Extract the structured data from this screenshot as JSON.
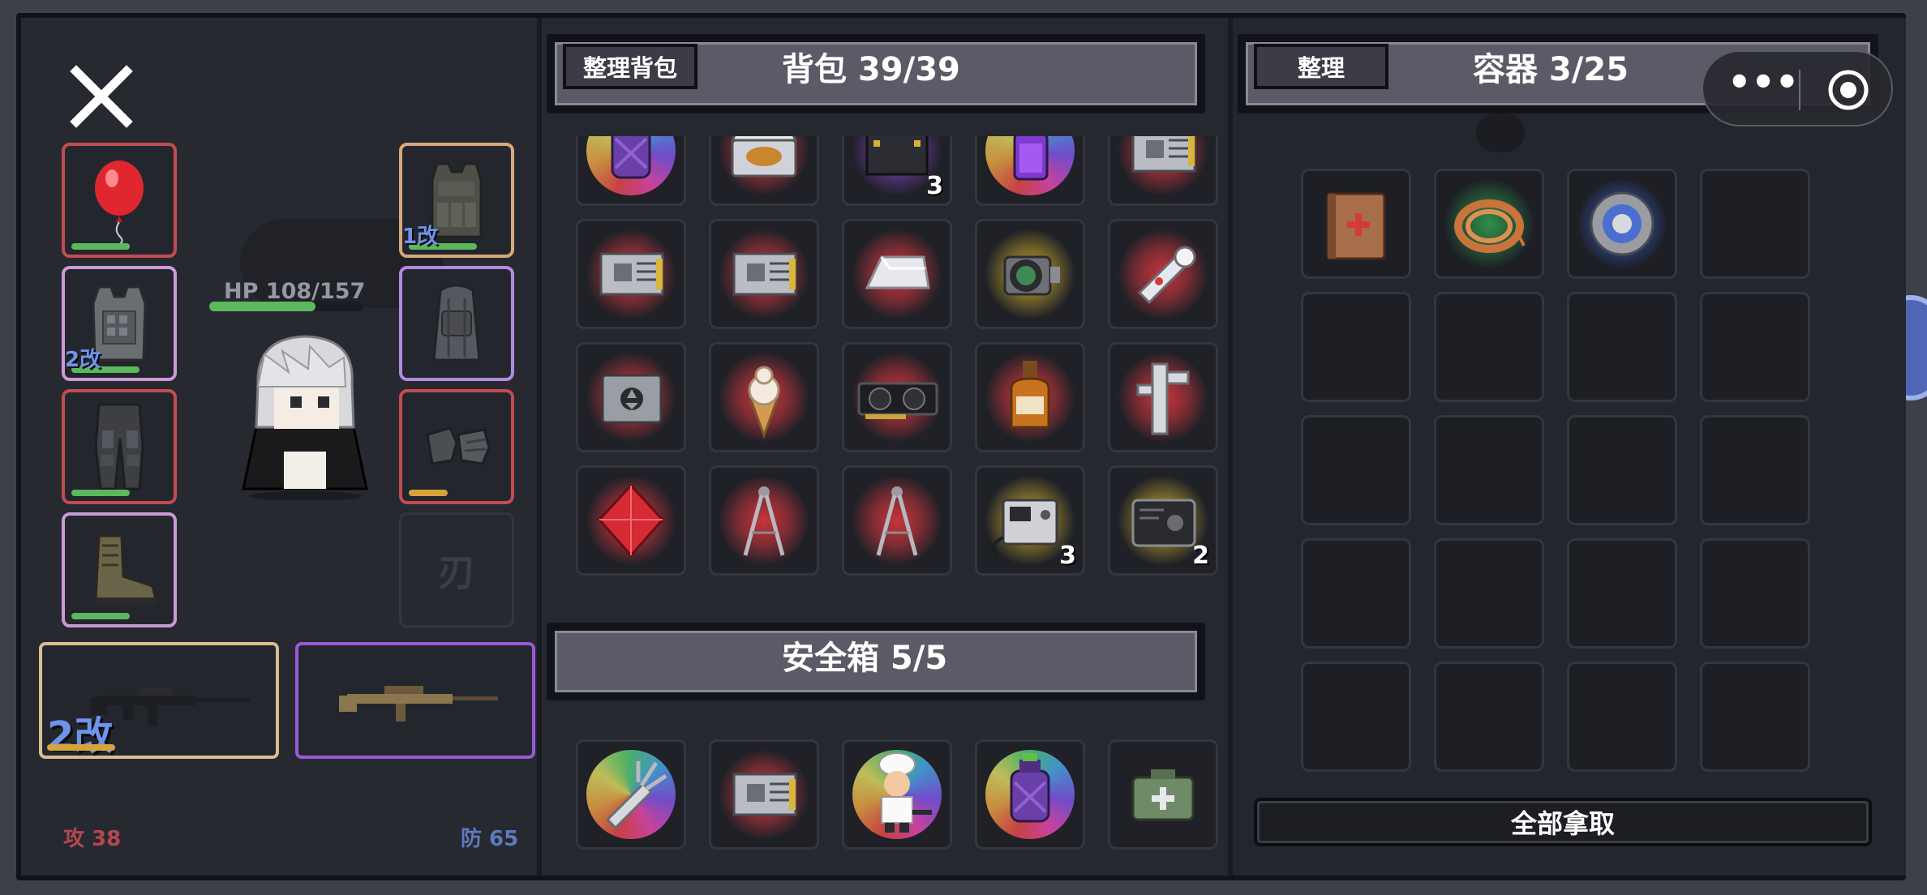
{
  "left": {
    "hp_text": "HP 108/157",
    "hp_fraction": 0.688,
    "atk": "攻 38",
    "def": "防 65",
    "slots": {
      "balloon": {
        "bar": 0.6,
        "bar_color": "#5cb85c"
      },
      "armor": {
        "bar": 0.7,
        "mod": "2改"
      },
      "pants": {
        "bar": 0.6
      },
      "boots": {
        "bar": 0.6
      },
      "rig": {
        "bar": 0.7,
        "mod": "1改"
      },
      "backpack": {
        "bar": 0
      },
      "gloves": {
        "bar": 0.4,
        "bar_color": "#d6a43a"
      },
      "melee_placeholder": "刃"
    },
    "weapon1_mod": "2改",
    "weapon1_bar": 0.3
  },
  "backpack": {
    "sort_label": "整理背包",
    "title": "背包 39/39",
    "rows": [
      [
        {
          "icon": "purple-bottle",
          "glow": "rainbow"
        },
        {
          "icon": "food-tin",
          "glow": "red"
        },
        {
          "icon": "ammo-box",
          "glow": "purple",
          "count": "3"
        },
        {
          "icon": "purple-vial",
          "glow": "rainbow"
        },
        {
          "icon": "circuit-board",
          "glow": "red"
        }
      ],
      [
        {
          "icon": "circuit-board",
          "glow": "red"
        },
        {
          "icon": "circuit-board",
          "glow": "red"
        },
        {
          "icon": "silver-ingot",
          "glow": "red"
        },
        {
          "icon": "camera-lens",
          "glow": "gold"
        },
        {
          "icon": "flashlight",
          "glow": "red"
        }
      ],
      [
        {
          "icon": "hazard-case",
          "glow": "red"
        },
        {
          "icon": "ice-cream",
          "glow": "red"
        },
        {
          "icon": "graphics-card",
          "glow": "red"
        },
        {
          "icon": "liquor-bottle",
          "glow": "red"
        },
        {
          "icon": "caliper",
          "glow": "red"
        }
      ],
      [
        {
          "icon": "red-gem",
          "glow": "red"
        },
        {
          "icon": "compass-tool",
          "glow": "red"
        },
        {
          "icon": "compass-tool",
          "glow": "red"
        },
        {
          "icon": "welder",
          "glow": "gold",
          "count": "3"
        },
        {
          "icon": "wallet",
          "glow": "gold",
          "count": "2"
        }
      ]
    ]
  },
  "safebox": {
    "title": "安全箱 5/5",
    "items": [
      {
        "icon": "multitool",
        "glow": "rainbow"
      },
      {
        "icon": "circuit-board",
        "glow": "red"
      },
      {
        "icon": "chef-figure",
        "glow": "rainbow"
      },
      {
        "icon": "purple-bottle",
        "glow": "rainbow"
      },
      {
        "icon": "medkit",
        "glow": "none"
      }
    ]
  },
  "container": {
    "sort_label": "整理",
    "title": "容器 3/25",
    "take_all": "全部拿取",
    "items": [
      {
        "icon": "medical-book",
        "glow": "none"
      },
      {
        "icon": "copper-coil",
        "glow": "green"
      },
      {
        "icon": "bearing",
        "glow": "blue"
      }
    ]
  },
  "colors": {
    "red_glow": "#c8343c",
    "gold_glow": "#b89a2a",
    "purple_glow": "#7a3fb3",
    "green_glow": "#2f8f4a",
    "blue_glow": "#3a62c9",
    "hp_green": "#5cb85c"
  }
}
